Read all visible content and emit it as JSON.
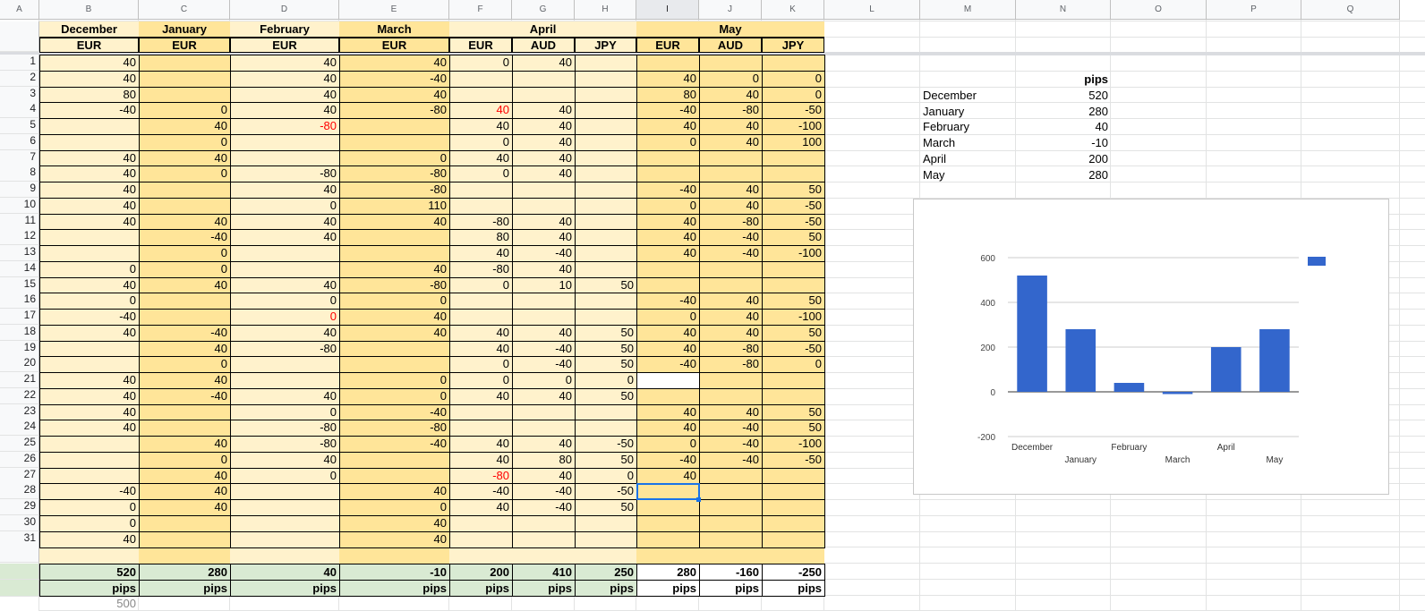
{
  "colors": {
    "pale": "#fff2cc",
    "gold": "#ffe599",
    "green": "#d9ead3",
    "bar": "#3366cc"
  },
  "columns": [
    "A",
    "B",
    "C",
    "D",
    "E",
    "F",
    "G",
    "H",
    "I",
    "J",
    "K",
    "L",
    "M",
    "N",
    "O",
    "P",
    "Q"
  ],
  "header": {
    "months": [
      "December",
      "January",
      "February",
      "March",
      "April",
      "May"
    ],
    "currencies": [
      "EUR",
      "EUR",
      "EUR",
      "EUR",
      "EUR",
      "AUD",
      "JPY",
      "EUR",
      "AUD",
      "JPY"
    ]
  },
  "rows": [
    [
      "40",
      "",
      "40",
      "40",
      "0",
      "40",
      "",
      "",
      "",
      ""
    ],
    [
      "40",
      "",
      "40",
      "-40",
      "",
      "",
      "",
      "40",
      "0",
      "0"
    ],
    [
      "80",
      "",
      "40",
      "40",
      "",
      "",
      "",
      "80",
      "40",
      "0"
    ],
    [
      "-40",
      "0",
      "40",
      "-80",
      "40",
      "40",
      "",
      "-40",
      "-80",
      "-50"
    ],
    [
      "",
      "40",
      "-80",
      "",
      "40",
      "40",
      "",
      "40",
      "40",
      "-100"
    ],
    [
      "",
      "0",
      "",
      "",
      "0",
      "40",
      "",
      "0",
      "40",
      "100"
    ],
    [
      "40",
      "40",
      "",
      "0",
      "40",
      "40",
      "",
      "",
      "",
      ""
    ],
    [
      "40",
      "0",
      "-80",
      "-80",
      "0",
      "40",
      "",
      "",
      "",
      ""
    ],
    [
      "40",
      "",
      "40",
      "-80",
      "",
      "",
      "",
      "-40",
      "40",
      "50"
    ],
    [
      "40",
      "",
      "0",
      "110",
      "",
      "",
      "",
      "0",
      "40",
      "-50"
    ],
    [
      "40",
      "40",
      "40",
      "40",
      "-80",
      "40",
      "",
      "40",
      "-80",
      "-50"
    ],
    [
      "",
      "-40",
      "40",
      "",
      "80",
      "40",
      "",
      "40",
      "-40",
      "50"
    ],
    [
      "",
      "0",
      "",
      "",
      "40",
      "-40",
      "",
      "40",
      "-40",
      "-100"
    ],
    [
      "0",
      "0",
      "",
      "40",
      "-80",
      "40",
      "",
      "",
      "",
      ""
    ],
    [
      "40",
      "40",
      "40",
      "-80",
      "0",
      "10",
      "50",
      "",
      "",
      ""
    ],
    [
      "0",
      "",
      "0",
      "0",
      "",
      "",
      "",
      "-40",
      "40",
      "50"
    ],
    [
      "-40",
      "",
      "0",
      "40",
      "",
      "",
      "",
      "0",
      "40",
      "-100"
    ],
    [
      "40",
      "-40",
      "40",
      "40",
      "40",
      "40",
      "50",
      "40",
      "40",
      "50"
    ],
    [
      "",
      "40",
      "-80",
      "",
      "40",
      "-40",
      "50",
      "40",
      "-80",
      "-50"
    ],
    [
      "",
      "0",
      "",
      "",
      "0",
      "-40",
      "50",
      "-40",
      "-80",
      "0"
    ],
    [
      "40",
      "40",
      "",
      "0",
      "0",
      "0",
      "0",
      "",
      "",
      ""
    ],
    [
      "40",
      "-40",
      "40",
      "0",
      "40",
      "40",
      "50",
      "",
      "",
      ""
    ],
    [
      "40",
      "",
      "0",
      "-40",
      "",
      "",
      "",
      "40",
      "40",
      "50"
    ],
    [
      "40",
      "",
      "-80",
      "-80",
      "",
      "",
      "",
      "40",
      "-40",
      "50"
    ],
    [
      "",
      "40",
      "-80",
      "-40",
      "40",
      "40",
      "-50",
      "0",
      "-40",
      "-100"
    ],
    [
      "",
      "0",
      "40",
      "",
      "40",
      "80",
      "50",
      "-40",
      "-40",
      "-50"
    ],
    [
      "",
      "40",
      "0",
      "",
      "-80",
      "40",
      "0",
      "40",
      "",
      ""
    ],
    [
      "-40",
      "40",
      "",
      "40",
      "-40",
      "-40",
      "-50",
      "",
      "",
      ""
    ],
    [
      "0",
      "40",
      "",
      "0",
      "40",
      "-40",
      "50",
      "",
      "",
      ""
    ],
    [
      "0",
      "",
      "",
      "40",
      "",
      "",
      "",
      "",
      "",
      ""
    ],
    [
      "40",
      "",
      "",
      "40",
      "",
      "",
      "",
      "",
      "",
      ""
    ]
  ],
  "red_cells": [
    [
      3,
      4
    ],
    [
      4,
      2
    ],
    [
      16,
      2
    ],
    [
      26,
      4
    ]
  ],
  "totals": [
    "520",
    "280",
    "40",
    "-10",
    "200",
    "410",
    "250",
    "280",
    "-160",
    "-250"
  ],
  "totals_unit": "pips",
  "below_b": "500",
  "summary": {
    "header": "pips",
    "items": [
      {
        "label": "December",
        "value": "520"
      },
      {
        "label": "January",
        "value": "280"
      },
      {
        "label": "February",
        "value": "40"
      },
      {
        "label": "March",
        "value": "-10"
      },
      {
        "label": "April",
        "value": "200"
      },
      {
        "label": "May",
        "value": "280"
      }
    ]
  },
  "chart_data": {
    "type": "bar",
    "categories": [
      "December",
      "January",
      "February",
      "March",
      "April",
      "May"
    ],
    "series": [
      {
        "values": [
          520,
          280,
          40,
          -10,
          200,
          280
        ]
      }
    ],
    "yticks": [
      "600",
      "400",
      "200",
      "0",
      "-200"
    ],
    "ylim": [
      -200,
      600
    ],
    "grid": true,
    "legend": "right"
  }
}
